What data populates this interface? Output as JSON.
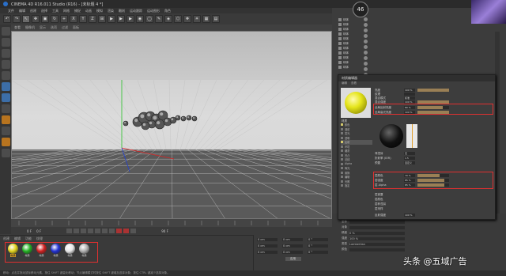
{
  "window": {
    "title": "CINEMA 4D R16.011 Studio (R16) - [未标题 4 *]"
  },
  "menubar": {
    "items": [
      "文件",
      "编辑",
      "创建",
      "选择",
      "工具",
      "网格",
      "捕捉",
      "动画",
      "模拟",
      "渲染",
      "雕刻",
      "运动跟踪",
      "运动图形",
      "角色"
    ]
  },
  "toolbar": {
    "buttons": [
      "↶",
      "↷",
      "↖",
      "✥",
      "▣",
      "↻",
      "+",
      "X",
      "Y",
      "Z",
      "⊞",
      "▶",
      "▶",
      "▶",
      "◉",
      "◯",
      "✎",
      "◈",
      "⬡",
      "❖",
      "☀",
      "▦",
      "▤"
    ]
  },
  "viewport": {
    "menu": [
      "查看",
      "摄像机",
      "显示",
      "选项",
      "过滤",
      "面板"
    ],
    "label": "透视视图",
    "grid_info": "网格间距：100 cm"
  },
  "timeline": {
    "start": "0 F",
    "current": "0 F",
    "end": "90 F"
  },
  "material_manager": {
    "menu": [
      "创建",
      "编辑",
      "功能",
      "纹理"
    ],
    "materials": [
      {
        "name": "材质",
        "color": "#e0d21a",
        "selected": true
      },
      {
        "name": "材质",
        "color": "#22b022",
        "selected": false
      },
      {
        "name": "材质",
        "color": "#d02020",
        "selected": false
      },
      {
        "name": "材质",
        "color": "#2030d0",
        "selected": false
      },
      {
        "name": "材质",
        "color": "#e8e8e8",
        "selected": false
      },
      {
        "name": "材质",
        "color": "#b0b0b0",
        "selected": false
      }
    ]
  },
  "coords": {
    "rows": [
      {
        "a": "0 cm",
        "b": "0 cm",
        "c": "0 °"
      },
      {
        "a": "0 cm",
        "b": "0 cm",
        "c": "0 °"
      },
      {
        "a": "0 cm",
        "b": "0 cm",
        "c": "0 °"
      }
    ],
    "apply": "应用"
  },
  "statusbar": {
    "text": "移动：点击并拖动鼠标移动元素。按住 SHIFT 键量化移动；节点编辑模式时按住 SHIFT 键增加选择对象；按住 CTRL 键减少选择对象。"
  },
  "object_manager": {
    "menu": [
      "文件",
      "编辑",
      "查看",
      "对象",
      "标签",
      "书签"
    ],
    "objects": [
      "球体",
      "球体",
      "球体",
      "球体",
      "球体",
      "球体",
      "球体",
      "球体",
      "球体",
      "球体",
      "球体"
    ]
  },
  "badge": {
    "value": "46"
  },
  "material_editor": {
    "title": "材质编辑器",
    "menu": [
      "编辑",
      "查看"
    ],
    "material_name": "材质",
    "rows": [
      {
        "label": "亮度",
        "value": "100 %",
        "fill": 1.0
      },
      {
        "label": "纹理",
        "value": "",
        "fill": 0
      },
      {
        "label": "混合模式",
        "value": "标准",
        "fill": 0
      },
      {
        "label": "混合强度",
        "value": "100 %",
        "fill": 1.0
      }
    ],
    "highlight_rows": [
      {
        "label": "全局反射亮度",
        "value": "80 %",
        "fill": 0.8
      },
      {
        "label": "全局高光亮度",
        "value": "100 %",
        "fill": 1.0
      }
    ],
    "channels": [
      {
        "name": "颜色",
        "on": true
      },
      {
        "name": "漫射",
        "on": false
      },
      {
        "name": "发光",
        "on": false
      },
      {
        "name": "透明",
        "on": false
      },
      {
        "name": "反射",
        "on": true
      },
      {
        "name": "环境",
        "on": false
      },
      {
        "name": "烟雾",
        "on": false
      },
      {
        "name": "凹凸",
        "on": false
      },
      {
        "name": "法线",
        "on": false
      },
      {
        "name": "Alpha",
        "on": false
      },
      {
        "name": "辉光",
        "on": false
      },
      {
        "name": "置换",
        "on": false
      },
      {
        "name": "编辑",
        "on": false
      },
      {
        "name": "光照",
        "on": false
      },
      {
        "name": "指定",
        "on": false
      }
    ],
    "fresnel_rows": [
      {
        "label": "菲涅耳",
        "value": "无"
      },
      {
        "label": "折射率 (IOR)",
        "value": "1.5"
      },
      {
        "label": "预置",
        "value": "自定义"
      }
    ],
    "layer_rows": [
      {
        "label": "层颜色",
        "value": "70 %",
        "fill": 0.7
      },
      {
        "label": "层强度",
        "value": "85 %",
        "fill": 0.85
      },
      {
        "label": "层 Alpha",
        "value": "85 %",
        "fill": 0.85
      }
    ],
    "sections": [
      "层遮罩",
      "层颜色",
      "层菲涅耳",
      "层采样"
    ],
    "bottom": {
      "label": "反射强度",
      "value": "100 %"
    }
  },
  "attribute_panel": {
    "rows": [
      {
        "label": "基本",
        "value": ""
      },
      {
        "label": "坐标",
        "value": ""
      },
      {
        "label": "对象",
        "value": ""
      },
      {
        "label": "精度",
        "value": "0 %"
      },
      {
        "label": "强度",
        "value": "100 %"
      },
      {
        "label": "类型",
        "value": "Lambertian"
      },
      {
        "label": "颜色",
        "value": ""
      }
    ]
  },
  "watermark": {
    "text": "头条 @五域广告"
  }
}
